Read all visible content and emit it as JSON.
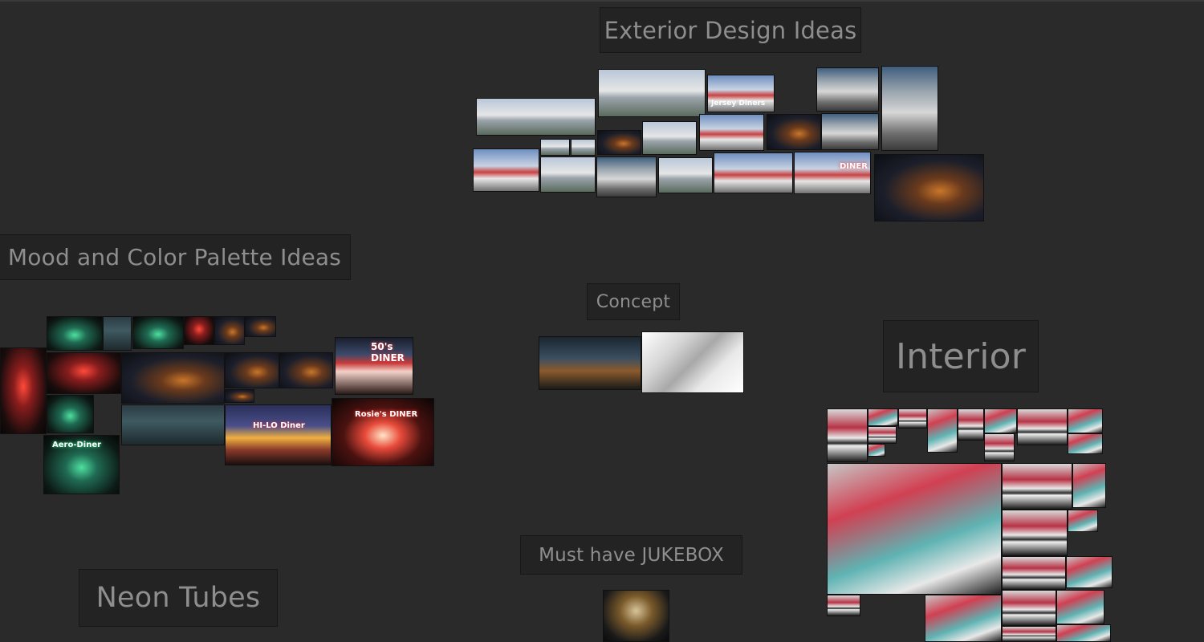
{
  "groups": {
    "exterior": {
      "title": "Exterior Design Ideas"
    },
    "mood": {
      "title": "Mood and Color Palette Ideas"
    },
    "concept": {
      "title": "Concept"
    },
    "interior": {
      "title": "Interior"
    },
    "jukebox": {
      "title": "Must have JUKEBOX"
    },
    "neon": {
      "title": "Neon Tubes"
    }
  },
  "thumb_signs": {
    "fifties_diner": "50's\nDINER",
    "hilo": "HI-LO Diner",
    "rosies": "Rosie's DINER",
    "aero": "Aero-Diner",
    "jersey": "Jersey Diners",
    "diner": "DINER"
  }
}
